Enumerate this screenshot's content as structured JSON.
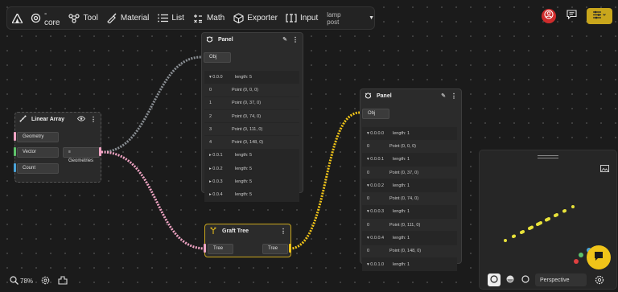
{
  "toolbar": {
    "core_label": "-core",
    "tool_label": "Tool",
    "material_label": "Material",
    "list_label": "List",
    "math_label": "Math",
    "exporter_label": "Exporter",
    "input_label": "Input",
    "dropdown_value": "lamp post"
  },
  "colors": {
    "accent_yellow": "#d7b21f",
    "wire_gray": "#8a8f94",
    "wire_pink": "#f0a4c4",
    "wire_yellow": "#f0c419",
    "alert_red": "#e04040"
  },
  "linear_array": {
    "title": "Linear Array",
    "inputs": [
      "Geometry",
      "Vector",
      "Count"
    ],
    "output": "Geometries"
  },
  "panel1": {
    "title": "Panel",
    "input": "Obj",
    "rows": [
      {
        "k": "▾ 0.0.0",
        "v": "length: 5",
        "head": true
      },
      {
        "k": "0",
        "v": "Point (0, 0, 0)"
      },
      {
        "k": "1",
        "v": "Point (0, 37, 0)"
      },
      {
        "k": "2",
        "v": "Point (0, 74, 0)"
      },
      {
        "k": "3",
        "v": "Point (0, 111, 0)"
      },
      {
        "k": "4",
        "v": "Point (0, 148, 0)"
      },
      {
        "k": "▸ 0.0.1",
        "v": "length: 5",
        "head": true
      },
      {
        "k": "▸ 0.0.2",
        "v": "length: 5",
        "head": true
      },
      {
        "k": "▸ 0.0.3",
        "v": "length: 5",
        "head": true
      },
      {
        "k": "▸ 0.0.4",
        "v": "length: 5",
        "head": true
      }
    ]
  },
  "panel2": {
    "title": "Panel",
    "input": "Obj",
    "rows": [
      {
        "k": "▾ 0.0.0.0",
        "v": "length: 1",
        "head": true
      },
      {
        "k": "0",
        "v": "Point (0, 0, 0)"
      },
      {
        "k": "▾ 0.0.0.1",
        "v": "length: 1",
        "head": true
      },
      {
        "k": "0",
        "v": "Point (0, 37, 0)"
      },
      {
        "k": "▾ 0.0.0.2",
        "v": "length: 1",
        "head": true
      },
      {
        "k": "0",
        "v": "Point (0, 74, 0)"
      },
      {
        "k": "▾ 0.0.0.3",
        "v": "length: 1",
        "head": true
      },
      {
        "k": "0",
        "v": "Point (0, 111, 0)"
      },
      {
        "k": "▾ 0.0.0.4",
        "v": "length: 1",
        "head": true
      },
      {
        "k": "0",
        "v": "Point (0, 148, 0)"
      },
      {
        "k": "▾ 0.0.1.0",
        "v": "length: 1",
        "head": true
      }
    ]
  },
  "graft": {
    "title": "Graft Tree",
    "input": "Tree",
    "output": "Tree"
  },
  "viewport": {
    "projection": "Perspective"
  },
  "status": {
    "zoom": "78%"
  }
}
